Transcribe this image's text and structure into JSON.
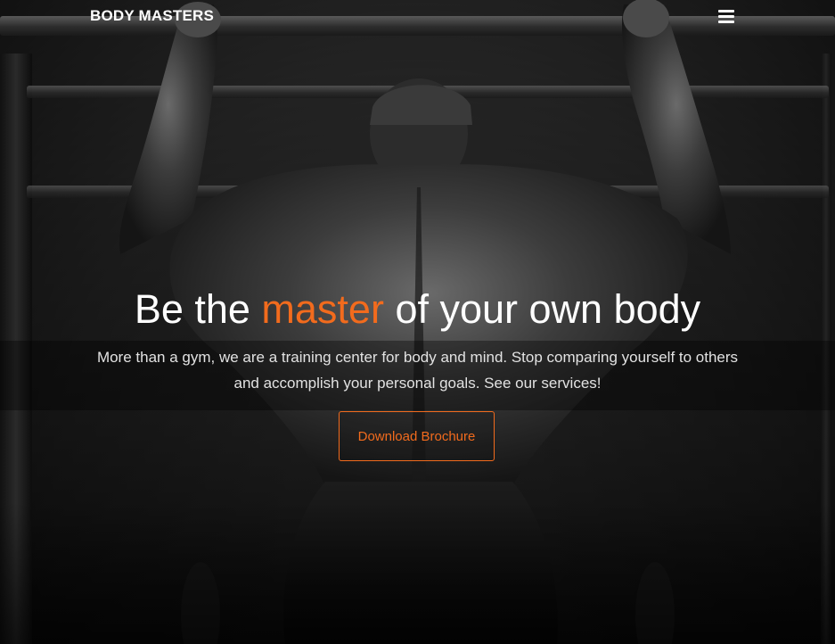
{
  "navbar": {
    "brand": "BODY MASTERS",
    "menu_icon": "hamburger-menu-icon"
  },
  "hero": {
    "headline_before": "Be the ",
    "headline_accent": "master",
    "headline_after": " of your own body",
    "subtext": "More than a gym, we are a training center for body and mind. Stop comparing yourself to others and accomplish your personal goals. See our services!",
    "cta_label": "Download Brochure",
    "background_image": "athlete-doing-pull-ups-photo"
  },
  "colors": {
    "accent": "#f26b1d",
    "text": "#ffffff",
    "subtext": "#e2e2e2"
  }
}
